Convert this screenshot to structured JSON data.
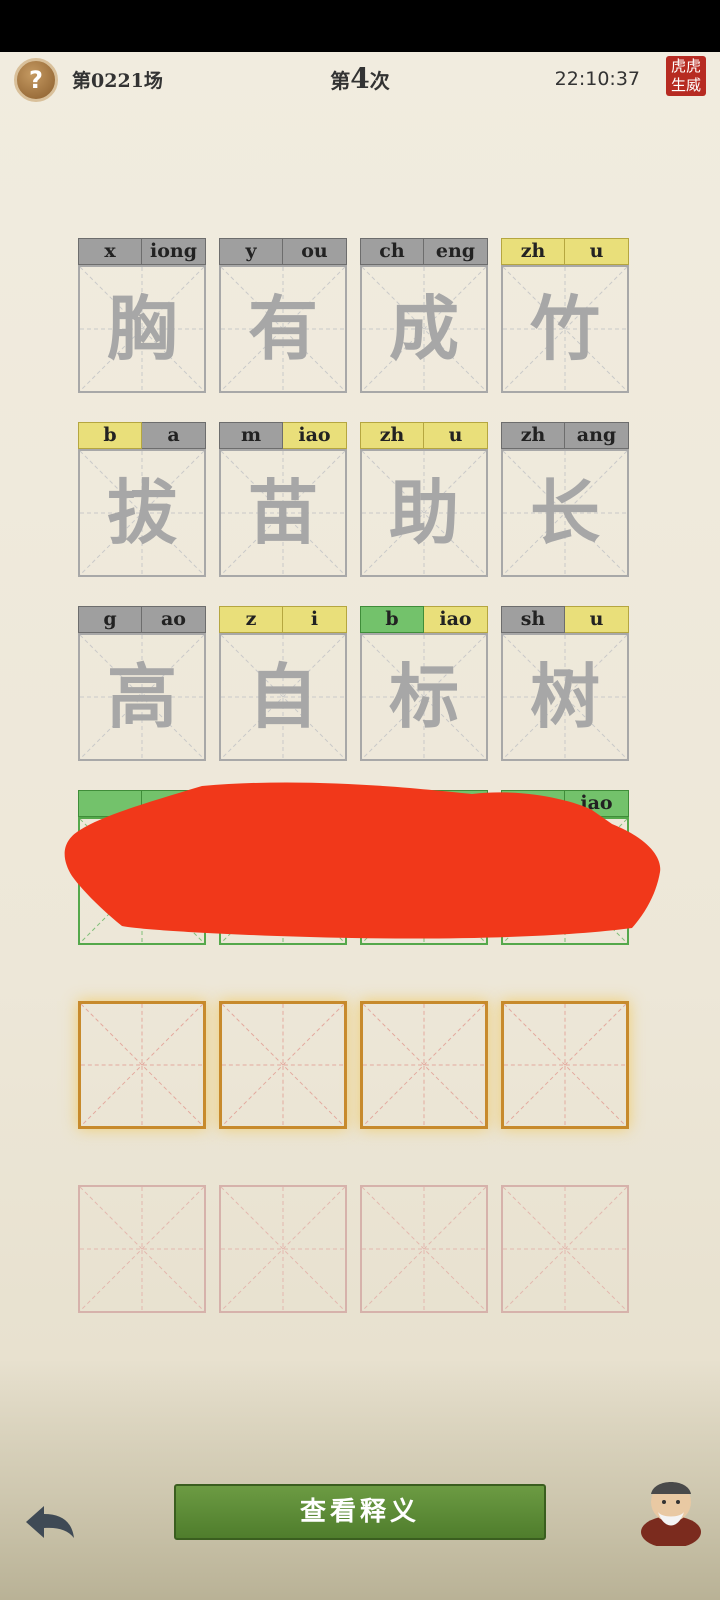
{
  "header": {
    "round": "第0221场",
    "attempt_prefix": "第",
    "attempt_number": "4",
    "attempt_suffix": "次",
    "time": "22:10:37",
    "seal_line1": "虎虎",
    "seal_line2": "生威"
  },
  "rows": [
    [
      {
        "initial": "x",
        "final": "iong",
        "char": "胸",
        "ini_color": "gray",
        "fin_color": "gray"
      },
      {
        "initial": "y",
        "final": "ou",
        "char": "有",
        "ini_color": "gray",
        "fin_color": "gray"
      },
      {
        "initial": "ch",
        "final": "eng",
        "char": "成",
        "ini_color": "gray",
        "fin_color": "gray"
      },
      {
        "initial": "zh",
        "final": "u",
        "char": "竹",
        "ini_color": "yellow",
        "fin_color": "yellow"
      }
    ],
    [
      {
        "initial": "b",
        "final": "a",
        "char": "拔",
        "ini_color": "yellow",
        "fin_color": "gray"
      },
      {
        "initial": "m",
        "final": "iao",
        "char": "苗",
        "ini_color": "gray",
        "fin_color": "yellow"
      },
      {
        "initial": "zh",
        "final": "u",
        "char": "助",
        "ini_color": "yellow",
        "fin_color": "yellow"
      },
      {
        "initial": "zh",
        "final": "ang",
        "char": "长",
        "ini_color": "gray",
        "fin_color": "gray"
      }
    ],
    [
      {
        "initial": "g",
        "final": "ao",
        "char": "高",
        "ini_color": "gray",
        "fin_color": "gray"
      },
      {
        "initial": "z",
        "final": "i",
        "char": "自",
        "ini_color": "yellow",
        "fin_color": "yellow"
      },
      {
        "initial": "b",
        "final": "iao",
        "char": "标",
        "ini_color": "green",
        "fin_color": "yellow"
      },
      {
        "initial": "sh",
        "final": "u",
        "char": "树",
        "ini_color": "gray",
        "fin_color": "yellow"
      }
    ]
  ],
  "row4_visible_final": "iao",
  "bottom": {
    "explain_button": "查看释义"
  },
  "icons": {
    "help": "question-icon",
    "back": "back-arrow-icon",
    "avatar": "sage-avatar"
  },
  "colors": {
    "gray": "#9f9f9f",
    "yellow": "#e9df7a",
    "green": "#73c26b",
    "active_border": "#c78a2c",
    "button": "#5a8a35"
  }
}
